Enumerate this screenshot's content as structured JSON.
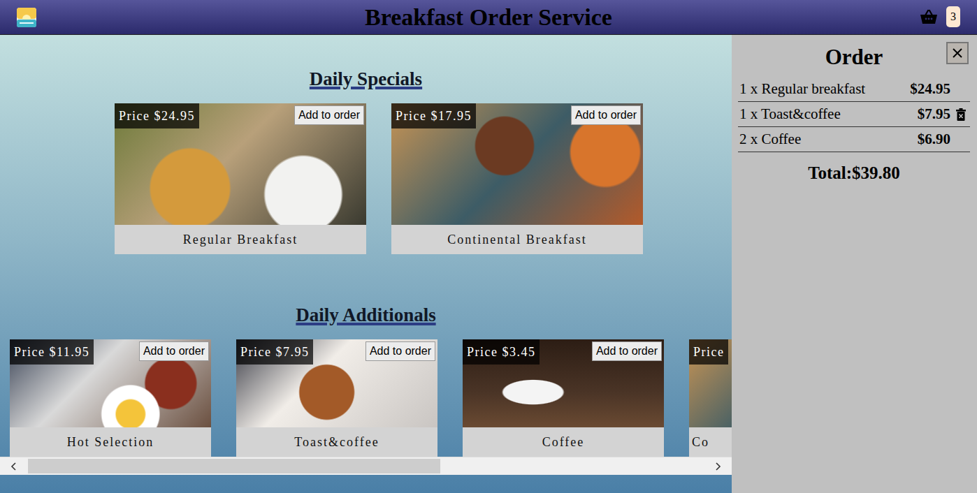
{
  "header": {
    "title": "Breakfast Order Service",
    "cart_count": "3"
  },
  "sections": [
    {
      "title": "Daily Specials",
      "kind": "specials",
      "items": [
        {
          "name": "Regular Breakfast",
          "price": "Price $24.95",
          "button": "Add to order",
          "cut": false
        },
        {
          "name": "Continental Breakfast",
          "price": "Price $17.95",
          "button": "Add to order",
          "cut": false
        }
      ]
    },
    {
      "title": "Daily Additionals",
      "kind": "additionals",
      "items": [
        {
          "name": "Hot Selection",
          "price": "Price $11.95",
          "button": "Add to order",
          "cut": false
        },
        {
          "name": "Toast&coffee",
          "price": "Price $7.95",
          "button": "Add to order",
          "cut": false
        },
        {
          "name": "Coffee",
          "price": "Price $3.45",
          "button": "Add to order",
          "cut": false
        },
        {
          "name": "Co",
          "price": "Price",
          "cut": true
        }
      ]
    }
  ],
  "scrollbar": {
    "level": 0.61
  },
  "order": {
    "title": "Order",
    "lines": [
      {
        "label": "1 x Regular breakfast",
        "price": "$24.95",
        "hovered": false
      },
      {
        "label": "1 x Toast&coffee",
        "price": "$7.95",
        "hovered": true
      },
      {
        "label": "2 x Coffee",
        "price": "$6.90",
        "hovered": false
      }
    ],
    "total": "Total:$39.80"
  }
}
